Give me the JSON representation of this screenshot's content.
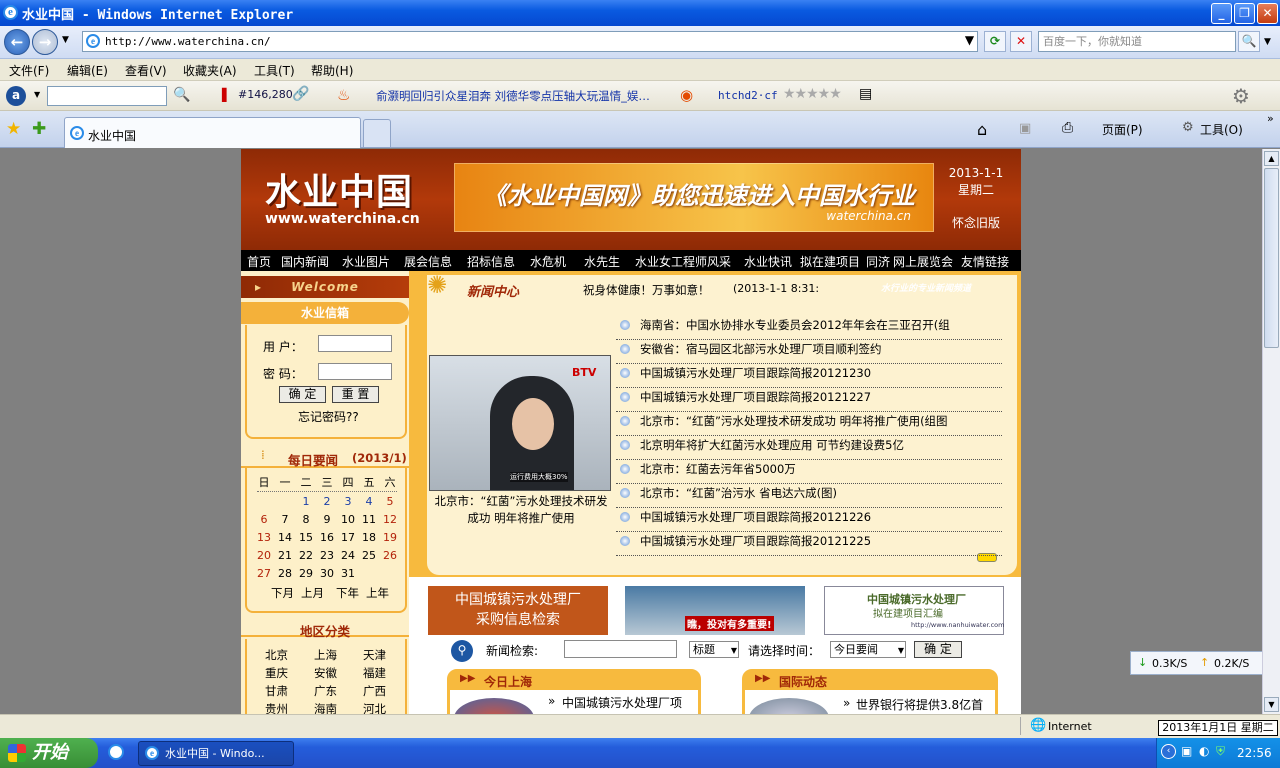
{
  "window": {
    "title": "水业中国 - Windows Internet Explorer",
    "minimize": "_",
    "maximize": "❐",
    "close": "✕"
  },
  "address": {
    "url": "http://www.waterchina.cn/",
    "search_placeholder": "百度一下，你就知道"
  },
  "menu": [
    "文件(F)",
    "编辑(E)",
    "查看(V)",
    "收藏夹(A)",
    "工具(T)",
    "帮助(H)"
  ],
  "toolbar2": {
    "rank": "#146,280",
    "news_ticker": "俞灏明回归引众星泪奔 刘德华零点压轴大玩温情_娱…",
    "user": "htchd2·cf"
  },
  "tab": {
    "title": "水业中国",
    "page_btn": "页面(P)",
    "tools_btn": "工具(O)"
  },
  "site": {
    "logo_cn": "水业中国",
    "logo_en": "www.waterchina.cn",
    "ad_text": "《水业中国网》助您迅速进入中国水行业",
    "ad_small": "waterchina.cn",
    "date": "2013-1-1",
    "weekday": "星期二",
    "old_version": "怀念旧版",
    "nav": [
      "首页",
      "国内新闻",
      "水业图片",
      "展会信息",
      "招标信息",
      "水危机",
      "水先生",
      "水业女工程师风采",
      "水业快讯",
      "拟在建项目",
      "同济",
      "网上展览会",
      "友情链接"
    ],
    "welcome": "Welcome",
    "mail_title": "水业信箱",
    "user_label": "用  户：",
    "pass_label": "密  码：",
    "ok_btn": "确 定",
    "reset_btn": "重 置",
    "forgot": "忘记密码??",
    "daily_title": "每日要闻",
    "daily_month": "(2013/1)",
    "weekdays": [
      "日",
      "一",
      "二",
      "三",
      "四",
      "五",
      "六"
    ],
    "cal_rows": [
      [
        "",
        "",
        "1",
        "2",
        "3",
        "4",
        "5"
      ],
      [
        "6",
        "7",
        "8",
        "9",
        "10",
        "11",
        "12"
      ],
      [
        "13",
        "14",
        "15",
        "16",
        "17",
        "18",
        "19"
      ],
      [
        "20",
        "21",
        "22",
        "23",
        "24",
        "25",
        "26"
      ],
      [
        "27",
        "28",
        "29",
        "30",
        "31",
        "",
        ""
      ]
    ],
    "cal_nav": [
      "下月",
      "上月",
      "下年",
      "上年"
    ],
    "region_title": "地区分类",
    "regions": [
      "北京",
      "上海",
      "天津",
      "重庆",
      "安徽",
      "福建",
      "甘肃",
      "广东",
      "广西",
      "贵州",
      "海南",
      "河北"
    ],
    "news_center": "新闻中心",
    "greeting": "祝身体健康！万事如意！",
    "datetime": "(2013-1-1 8:31:",
    "slogan": "水行业的专业新闻频道",
    "photo_caption": "北京市：“红菌”污水处理技术研发成功 明年将推广使用",
    "photo_overlay": "运行费用大概30%",
    "photo_brand": "BTV",
    "news": [
      "海南省：中国水协排水专业委员会2012年年会在三亚召开(组",
      "安徽省：宿马园区北部污水处理厂项目顺利签约",
      "中国城镇污水处理厂项目跟踪简报20121230",
      "中国城镇污水处理厂项目跟踪简报20121227",
      "北京市：“红菌”污水处理技术研发成功 明年将推广使用(组图",
      "北京明年将扩大红菌污水处理应用 可节约建设费5亿",
      "北京市：红菌去污年省5000万",
      "北京市：“红菌”治污水 省电达六成(图)",
      "中国城镇污水处理厂项目跟踪简报20121226",
      "中国城镇污水处理厂项目跟踪简报20121225"
    ],
    "promo1_line1": "中国城镇污水处理厂",
    "promo1_line2": "采购信息检索",
    "promo2": "瞧，投对有多重要!",
    "promo3_line1": "中国城镇污水处理厂",
    "promo3_line2": "拟在建项目汇编",
    "promo3_url": "http://www.nanhuiwater.com",
    "search_label": "新闻检索:",
    "search_type": "标题",
    "time_label": "请选择时间：",
    "time_value": "今日要闻",
    "search_ok": "确 定",
    "today_shanghai": "今日上海",
    "intl_news": "国际动态",
    "sh_item": "中国城镇污水处理厂项",
    "intl_item": "世界银行将提供3.8亿首"
  },
  "status": {
    "zone": "Internet",
    "date": "2013年1月1日 星期二",
    "down": "0.3K/S",
    "up": "0.2K/S"
  },
  "taskbar": {
    "start": "开始",
    "task": "水业中国 - Windo...",
    "clock": "22:56"
  }
}
